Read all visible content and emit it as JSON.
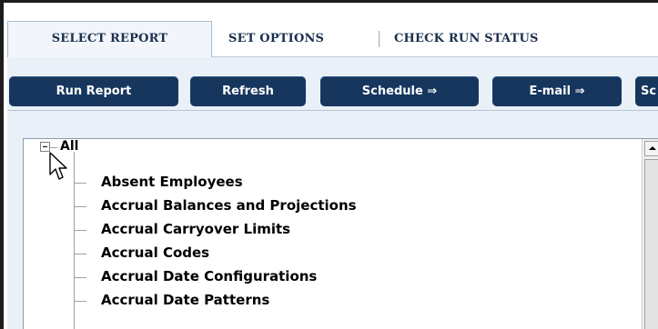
{
  "tabs": [
    {
      "label": "SELECT REPORT",
      "active": true
    },
    {
      "label": "SET OPTIONS",
      "active": false
    },
    {
      "label": "CHECK RUN STATUS",
      "active": false
    }
  ],
  "toolbar": {
    "run_report": "Run Report",
    "refresh": "Refresh",
    "schedule": "Schedule ⇒",
    "email": "E-mail ⇒",
    "more": "Sc"
  },
  "tree": {
    "root": "All",
    "items": [
      "Absent Employees",
      "Accrual Balances and Projections",
      "Accrual Carryover Limits",
      "Accrual Codes",
      "Accrual Date Configurations",
      "Accrual Date Patterns"
    ]
  },
  "colors": {
    "button_bg": "#16365e",
    "tab_text": "#1a2f4e",
    "toolbar_bg": "#eaf0f8"
  },
  "icons": {
    "expander": "minus-box-icon",
    "cursor": "mouse-pointer-icon",
    "scroll_up": "arrow-up-icon"
  }
}
